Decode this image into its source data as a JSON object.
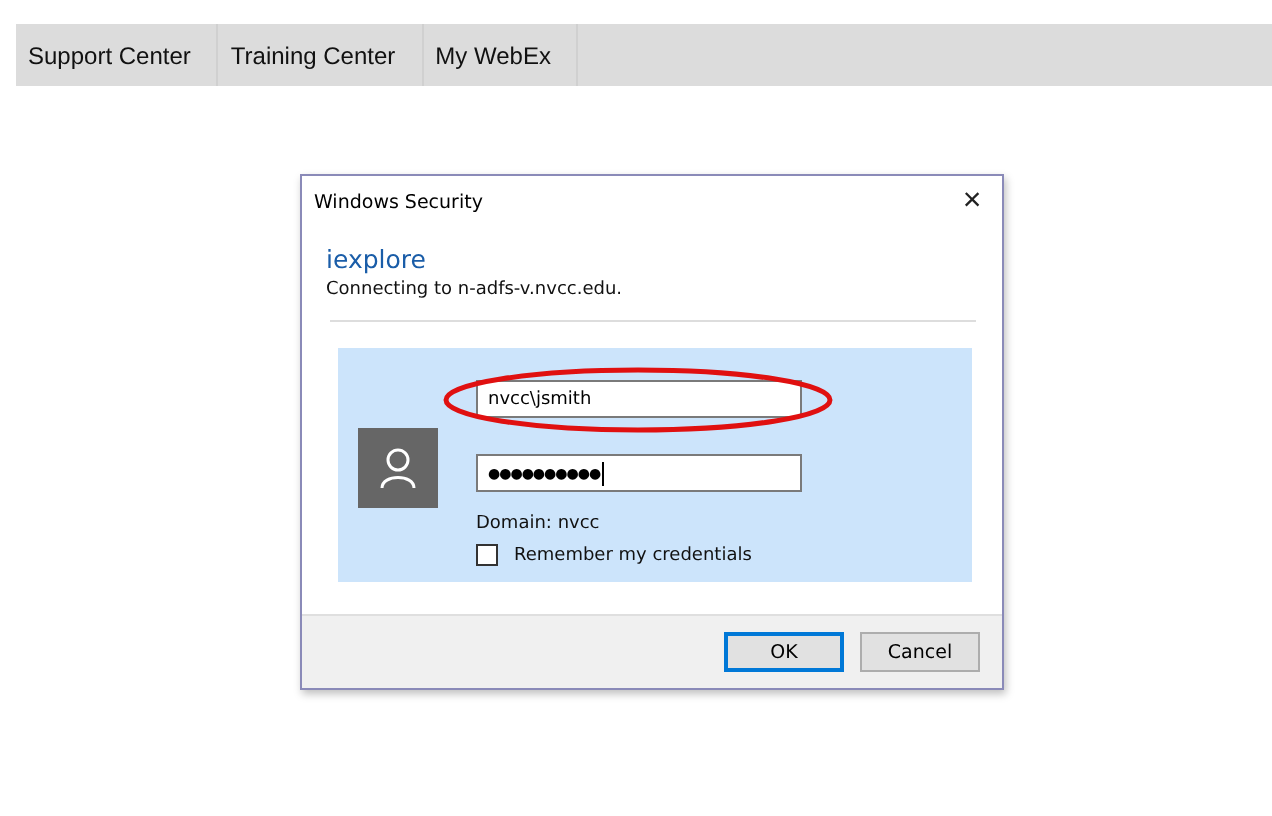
{
  "nav": {
    "tabs": [
      {
        "label": "Support Center"
      },
      {
        "label": "Training Center"
      },
      {
        "label": "My WebEx"
      }
    ]
  },
  "dialog": {
    "title": "Windows Security",
    "close": "×",
    "app": "iexplore",
    "message": "Connecting to n-adfs-v.nvcc.edu.",
    "username": {
      "value": "nvcc\\jsmith",
      "highlighted": true
    },
    "password": {
      "value": "●●●●●●●●●●"
    },
    "domain": "Domain: nvcc",
    "remember": {
      "label": "Remember my credentials",
      "checked": false
    },
    "buttons": [
      {
        "label": "OK",
        "kind": "default"
      },
      {
        "label": "Cancel",
        "kind": "normal"
      }
    ]
  }
}
